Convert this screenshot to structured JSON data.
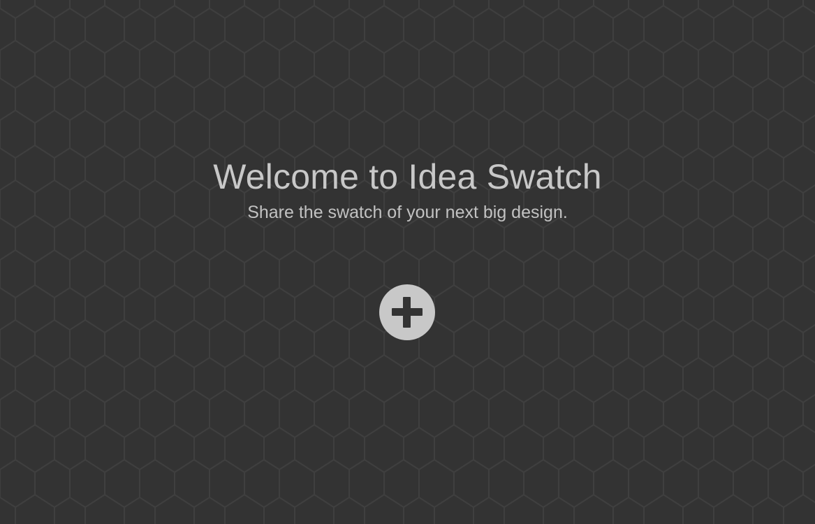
{
  "hero": {
    "title": "Welcome to Idea Swatch",
    "subtitle": "Share the swatch of your next big design."
  },
  "add_button": {
    "icon": "plus-icon"
  },
  "colors": {
    "background": "#333333",
    "pattern_line": "#3e3e3e",
    "text": "#c8c8c8",
    "button": "#c8c8c8"
  }
}
